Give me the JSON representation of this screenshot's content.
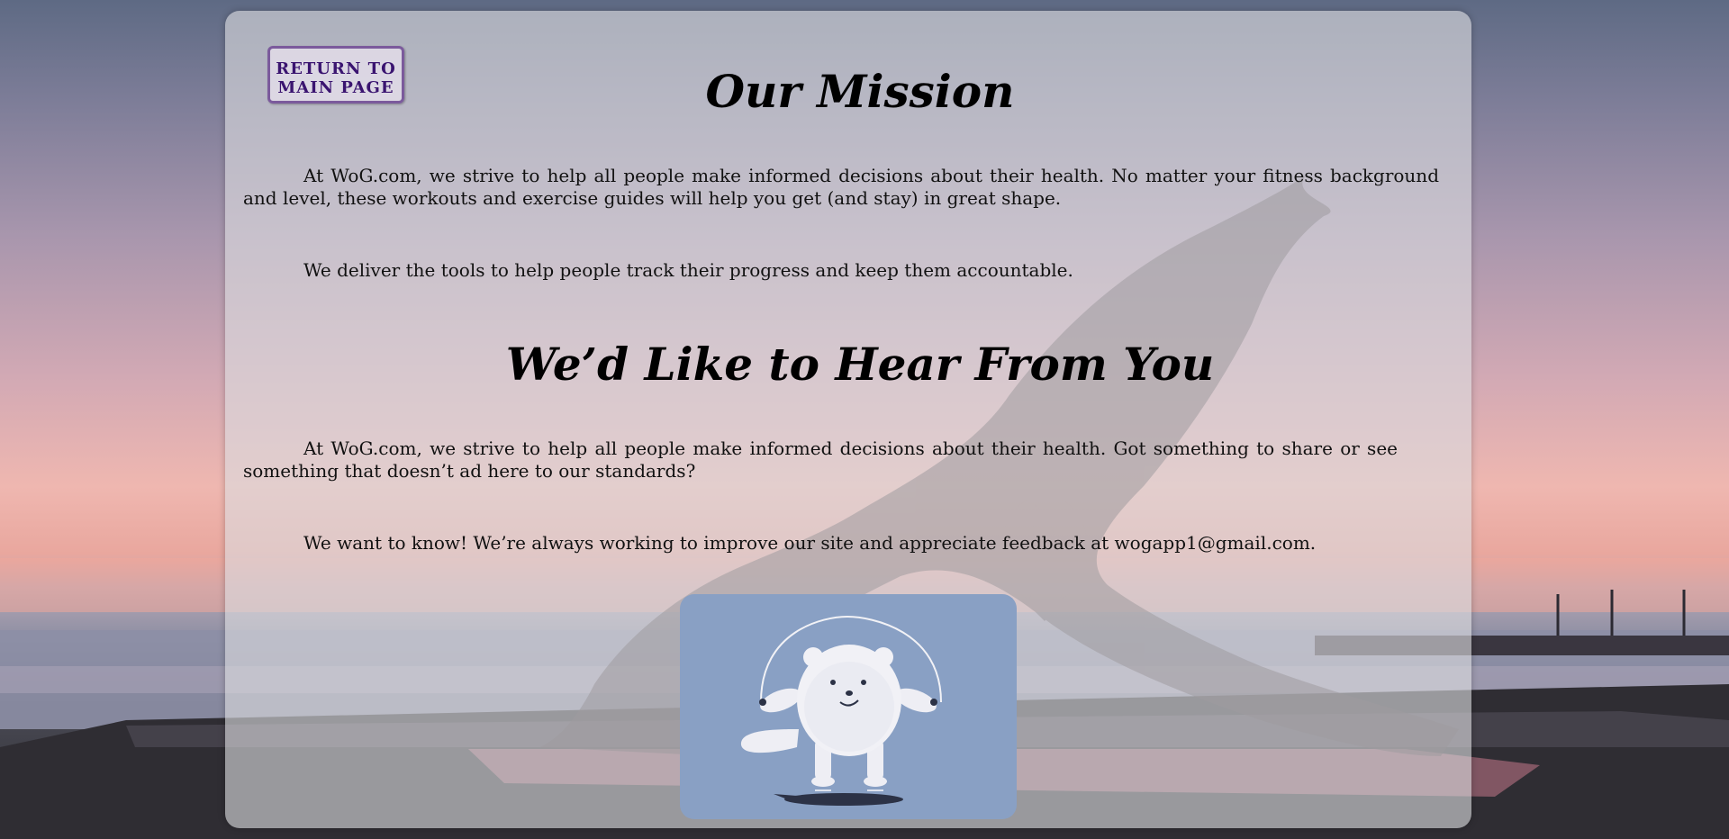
{
  "colors": {
    "panel": "#dcdcde",
    "button_border": "#7b5a9c",
    "button_text": "#3a1470",
    "mascot_bg": "#89a0c4"
  },
  "background": {
    "scene": "yoga silhouette at sunset by the sea"
  },
  "nav": {
    "return_line1": "RETURN TO",
    "return_line2": "MAIN PAGE"
  },
  "mission": {
    "title": "Our Mission",
    "paragraph1": "At WoG.com, we strive to help all people make informed decisions about their health. No matter your fitness background and level, these workouts and exercise guides will help you get (and stay) in great shape.",
    "paragraph2": "We deliver the tools to help people track their progress and keep them accountable."
  },
  "feedback": {
    "title": "We’d Like to Hear From You",
    "paragraph1": "At WoG.com, we strive to help all people make informed decisions about their health. Got something to share or see something that doesn’t ad here to our standards?",
    "paragraph2": "We want to know! We’re always working to improve our site and appreciate feedback at wogapp1@gmail.com."
  },
  "mascot": {
    "icon": "jump-rope-bear-icon"
  }
}
